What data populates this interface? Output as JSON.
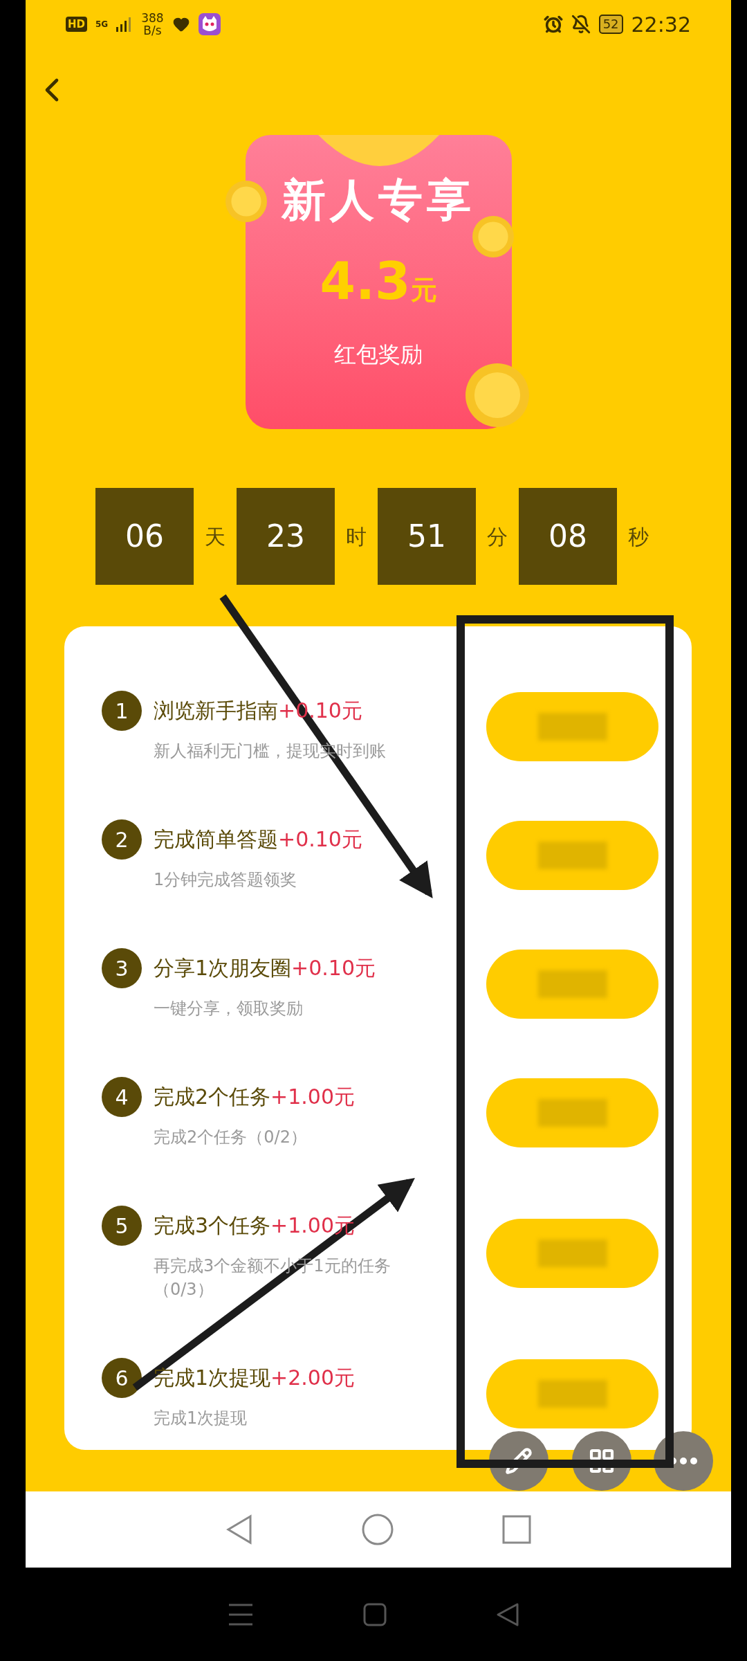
{
  "status_bar": {
    "hd": "HD",
    "network": "5G",
    "speed_value": "388",
    "speed_unit": "B/s",
    "battery": "52",
    "time": "22:32"
  },
  "banner": {
    "title": "新人专享",
    "amount": "4.3",
    "unit": "元",
    "caption": "红包奖励"
  },
  "countdown": [
    {
      "value": "06",
      "unit": "天"
    },
    {
      "value": "23",
      "unit": "时"
    },
    {
      "value": "51",
      "unit": "分"
    },
    {
      "value": "08",
      "unit": "秒"
    }
  ],
  "tasks": [
    {
      "number": "1",
      "title": "浏览新手指南",
      "reward": "+0.10元",
      "subtitle": "新人福利无门槛，提现实时到账"
    },
    {
      "number": "2",
      "title": "完成简单答题",
      "reward": "+0.10元",
      "subtitle": "1分钟完成答题领奖"
    },
    {
      "number": "3",
      "title": "分享1次朋友圈",
      "reward": "+0.10元",
      "subtitle": "一键分享，领取奖励"
    },
    {
      "number": "4",
      "title": "完成2个任务",
      "reward": "+1.00元",
      "subtitle": "完成2个任务（0/2）"
    },
    {
      "number": "5",
      "title": "完成3个任务",
      "reward": "+1.00元",
      "subtitle": "再完成3个金额不小于1元的任务（0/3）"
    },
    {
      "number": "6",
      "title": "完成1次提现",
      "reward": "+2.00元",
      "subtitle": "完成1次提现"
    }
  ]
}
